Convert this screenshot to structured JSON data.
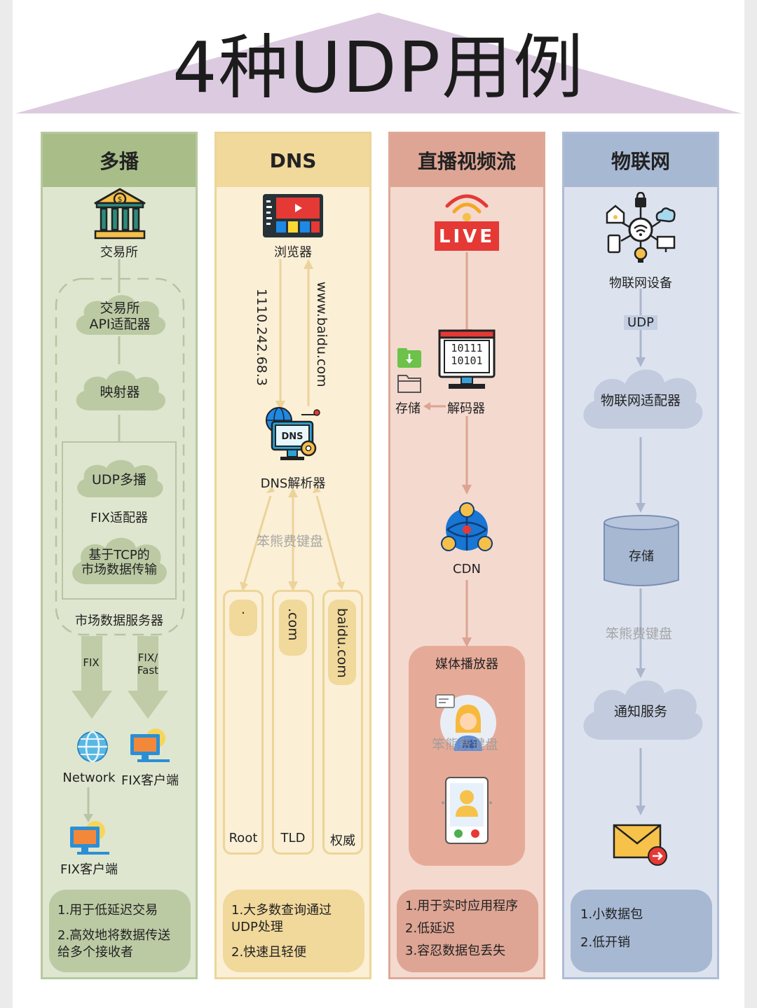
{
  "title": "4种UDP用例",
  "columns": {
    "multicast": {
      "header": "多播",
      "exchange": "交易所",
      "api_adapter": "交易所\nAPI适配器",
      "mapper": "映射器",
      "udp_multicast": "UDP多播",
      "fix_adapter": "FIX适配器",
      "tcp_market": "基于TCP的\n市场数据传输",
      "market_server": "市场数据服务器",
      "arrow_fix": "FIX",
      "arrow_fix_fast": "FIX/\nFast",
      "network": "Network",
      "fix_client_1": "FIX客户端",
      "fix_client_2": "FIX客户端",
      "summary_1": "1.用于低延迟交易",
      "summary_2": "2.高效地将数据传送给多个接收者"
    },
    "dns": {
      "header": "DNS",
      "browser": "浏览器",
      "ip": "1110.242.68.3",
      "domain": "www.baidu.com",
      "resolver": "DNS解析器",
      "watermark": "笨熊费键盘",
      "root_pill": ".",
      "tld_pill": ".com",
      "auth_pill": "baidu.com",
      "root": "Root",
      "tld": "TLD",
      "auth": "权威",
      "summary_1": "1.大多数查询通过UDP处理",
      "summary_2": "2.快速且轻便"
    },
    "live": {
      "header": "直播视频流",
      "live_badge": "LIVE",
      "decoder": "解码器",
      "storage": "存储",
      "binary": "10111\n10101",
      "cdn": "CDN",
      "player": "媒体播放器",
      "watermark": "笨熊费键盘",
      "summary_1": "1.用于实时应用程序",
      "summary_2": "2.低延迟",
      "summary_3": "3.容忍数据包丢失"
    },
    "iot": {
      "header": "物联网",
      "device": "物联网设备",
      "udp": "UDP",
      "adapter": "物联网适配器",
      "storage": "存储",
      "watermark": "笨熊费键盘",
      "notify": "通知服务",
      "summary_1": "1.小数据包",
      "summary_2": "2.低开销"
    }
  },
  "colors": {
    "green_bg": "#dfe6cf",
    "green_header": "#a9bd89",
    "green_border": "#b7c9a0",
    "yellow_bg": "#fbefd6",
    "yellow_header": "#f1d89b",
    "yellow_border": "#ecd597",
    "red_bg": "#f4d9cf",
    "red_header": "#dea594",
    "red_border": "#dea896",
    "blue_bg": "#dde3ee",
    "blue_header": "#a7b8d3",
    "blue_border": "#aebdd7",
    "roof": "#dccbe0"
  },
  "icons": [
    "bank-icon",
    "browser-icon",
    "dns-server-icon",
    "live-icon",
    "decoder-icon",
    "download-icon",
    "folder-icon",
    "cdn-icon",
    "support-agent-icon",
    "video-call-icon",
    "globe-icon",
    "computer-icon",
    "iot-hub-icon",
    "database-icon",
    "mail-icon"
  ]
}
